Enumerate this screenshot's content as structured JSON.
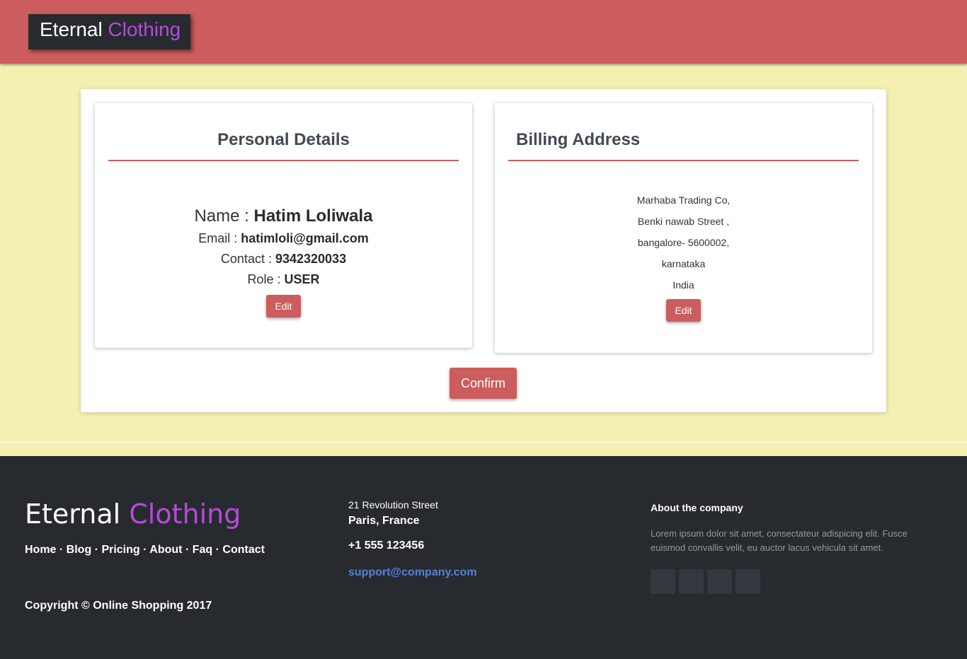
{
  "header": {
    "brand_word1": "Eternal",
    "brand_word2": "Clothing"
  },
  "personal": {
    "title": "Personal Details",
    "name_label": "Name : ",
    "name_value": "Hatim Loliwala",
    "email_label": "Email : ",
    "email_value": "hatimloli@gmail.com",
    "contact_label": "Contact : ",
    "contact_value": "9342320033",
    "role_label": "Role : ",
    "role_value": "USER",
    "edit_label": "Edit"
  },
  "billing": {
    "title": "Billing Address",
    "lines": [
      "Marhaba Trading Co,",
      "Benki nawab Street ,",
      "bangalore- 5600002,",
      "karnataka",
      "India"
    ],
    "edit_label": "Edit"
  },
  "confirm_label": "Confirm",
  "footer": {
    "brand_word1": "Eternal",
    "brand_word2": "Clothing",
    "links": [
      "Home",
      "Blog",
      "Pricing",
      "About",
      "Faq",
      "Contact"
    ],
    "link_separator": " · ",
    "copyright": "Copyright © Online Shopping 2017",
    "street": "21 Revolution Street",
    "city": "Paris, France",
    "phone": "+1 555 123456",
    "email": "support@company.com",
    "about_title": "About the company",
    "about_text": "Lorem ipsum dolor sit amet, consectateur adispicing elit. Fusce euismod convallis velit, eu auctor lacus vehicula sit amet."
  },
  "colors": {
    "accent": "#cd5c5c",
    "background": "#f3f0b2",
    "dark": "#272b30",
    "brand_highlight": "#b84ad6",
    "link_blue": "#5383d3"
  }
}
